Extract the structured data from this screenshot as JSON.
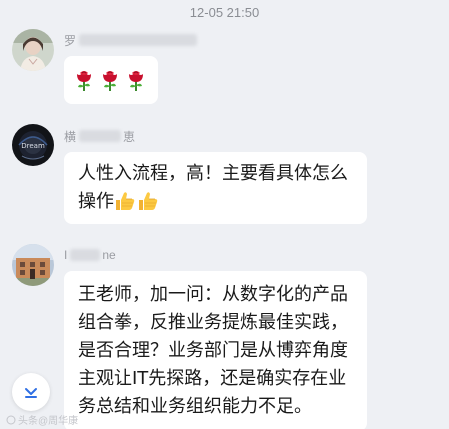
{
  "chat": {
    "timestamp": "12-05 21:50",
    "messages": [
      {
        "sender_visible": "罗",
        "emoji_name": "rose",
        "emoji_count": 3,
        "text": ""
      },
      {
        "sender_visible": "横",
        "sender_suffix": "恵",
        "text": "人性入流程，高！主要看具体怎么操作",
        "emoji_name": "thumbs-up",
        "emoji_count": 2
      },
      {
        "sender_visible": "I",
        "sender_suffix": "ne",
        "text": "王老师，加一问：从数字化的产品组合拳，反推业务提炼最佳实践，是否合理？业务部门是从博弈角度主观让IT先探路，还是确实存在业务总结和业务组织能力不足。"
      }
    ]
  },
  "scroll_button": {
    "icon": "chevron-down-icon"
  },
  "watermark": {
    "text": "头条@周华康"
  },
  "colors": {
    "background": "#eef0f4",
    "bubble": "#ffffff",
    "timestamp": "#8a8d93",
    "text": "#1a1a1a"
  }
}
